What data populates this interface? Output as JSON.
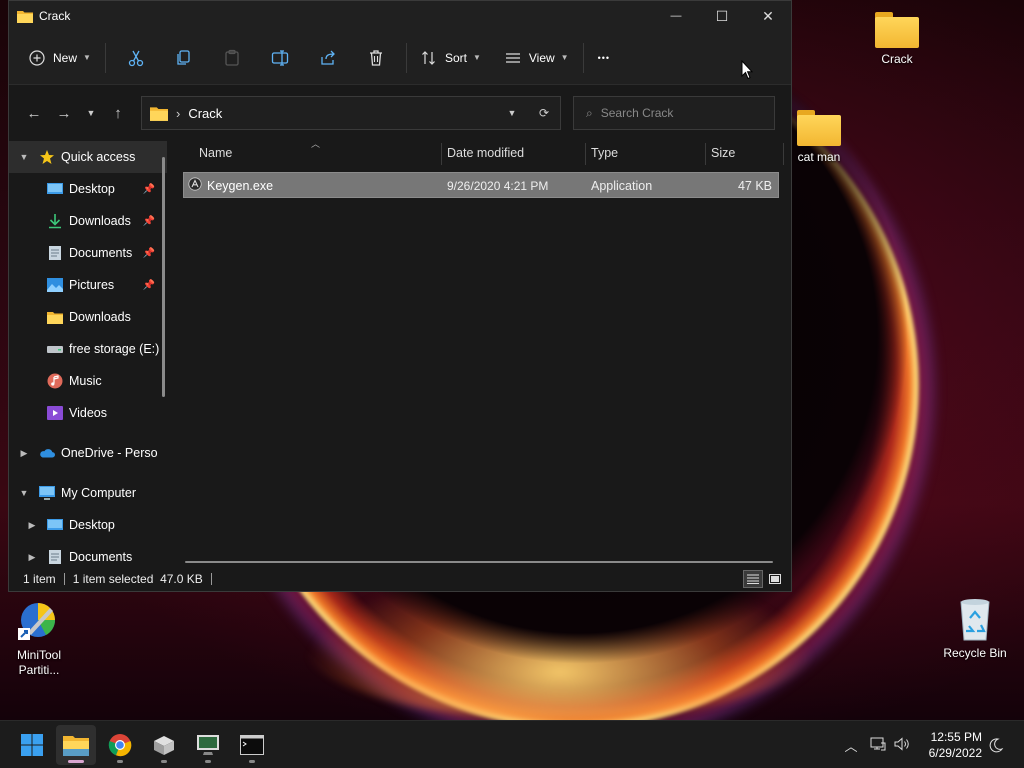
{
  "window": {
    "title": "Crack",
    "min_glyph": "—",
    "max_glyph": "☐",
    "close_glyph": "✕"
  },
  "toolbar": {
    "new_label": "New",
    "sort_label": "Sort",
    "view_label": "View",
    "more_glyph": "•••"
  },
  "address": {
    "separator": "›",
    "folder": "Crack",
    "search_placeholder": "Search Crack"
  },
  "nav": {
    "quick_access": "Quick access",
    "items": [
      {
        "label": "Desktop",
        "pinned": true
      },
      {
        "label": "Downloads",
        "pinned": true
      },
      {
        "label": "Documents",
        "pinned": true
      },
      {
        "label": "Pictures",
        "pinned": true
      },
      {
        "label": "Downloads",
        "pinned": false
      },
      {
        "label": "free storage (E:)",
        "pinned": false
      },
      {
        "label": "Music",
        "pinned": false
      },
      {
        "label": "Videos",
        "pinned": false
      }
    ],
    "onedrive": "OneDrive - Perso",
    "my_computer": "My Computer",
    "mc_items": [
      "Desktop",
      "Documents"
    ]
  },
  "columns": {
    "name": "Name",
    "date": "Date modified",
    "type": "Type",
    "size": "Size"
  },
  "files": [
    {
      "name": "Keygen.exe",
      "date": "9/26/2020 4:21 PM",
      "type": "Application",
      "size": "47 KB"
    }
  ],
  "status": {
    "count": "1 item",
    "selected": "1 item selected  47.0 KB"
  },
  "desktop": {
    "crack_folder": "Crack",
    "catman_folder": "cat man",
    "minitool": "MiniTool Partiti...",
    "recycle": "Recycle Bin"
  },
  "clock": {
    "time": "12:55 PM",
    "date": "6/29/2022"
  },
  "colors": {
    "accent": "#0078d4",
    "folder": "#f2b631",
    "selection": "#777777"
  }
}
